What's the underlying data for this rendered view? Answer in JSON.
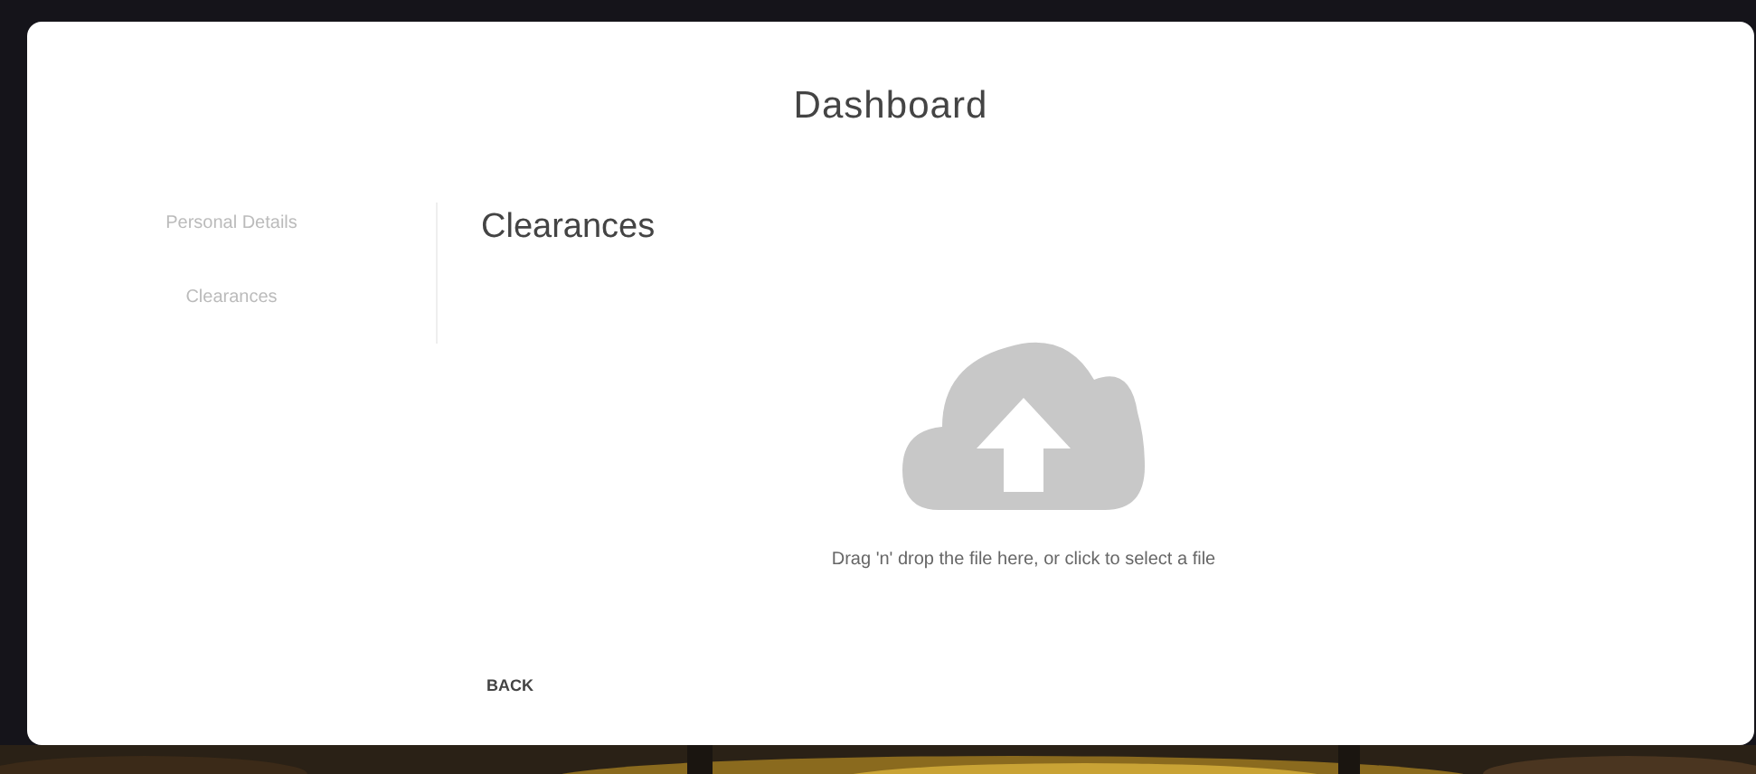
{
  "window": {
    "title": "Dashboard"
  },
  "sidebar": {
    "items": [
      {
        "label": "Personal Details"
      },
      {
        "label": "Clearances"
      }
    ]
  },
  "section": {
    "title": "Clearances"
  },
  "dropzone": {
    "text": "Drag 'n' drop the file here, or click to select a file"
  },
  "buttons": [
    "BACK"
  ]
}
